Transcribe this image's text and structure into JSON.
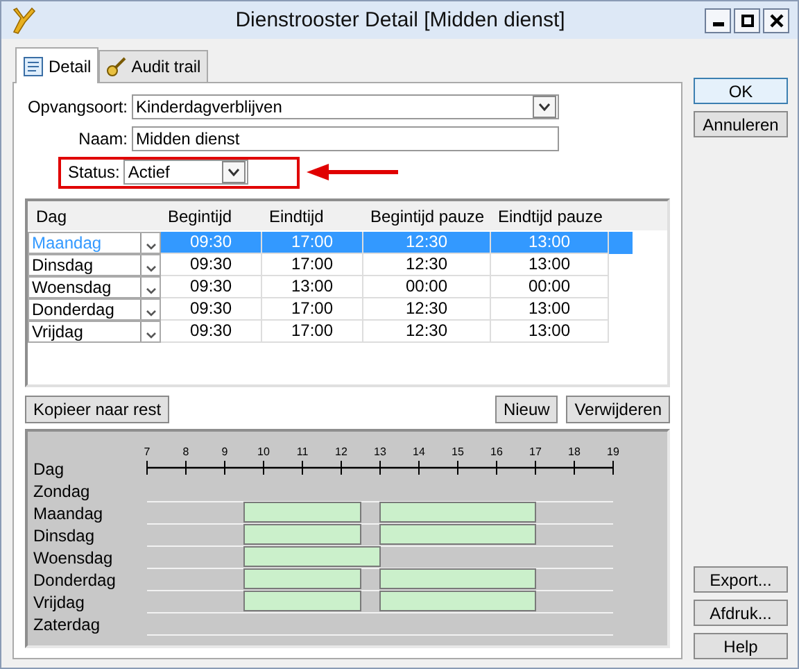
{
  "window": {
    "title": "Dienstrooster Detail [Midden dienst]"
  },
  "tabs": [
    {
      "label": "Detail",
      "selected": true
    },
    {
      "label": "Audit trail",
      "selected": false
    }
  ],
  "form": {
    "opvangsoort": {
      "label": "Opvangsoort:",
      "value": "Kinderdagverblijven"
    },
    "naam": {
      "label": "Naam:",
      "value": "Midden dienst"
    },
    "status": {
      "label": "Status:",
      "value": "Actief",
      "highlighted": true
    }
  },
  "table": {
    "columns": [
      "Dag",
      "Begintijd",
      "Eindtijd",
      "Begintijd pauze",
      "Eindtijd pauze"
    ],
    "rows": [
      {
        "cells": [
          "Maandag",
          "09:30",
          "17:00",
          "12:30",
          "13:00"
        ],
        "selected": true
      },
      {
        "cells": [
          "Dinsdag",
          "09:30",
          "17:00",
          "12:30",
          "13:00"
        ],
        "selected": false
      },
      {
        "cells": [
          "Woensdag",
          "09:30",
          "13:00",
          "00:00",
          "00:00"
        ],
        "selected": false
      },
      {
        "cells": [
          "Donderdag",
          "09:30",
          "17:00",
          "12:30",
          "13:00"
        ],
        "selected": false
      },
      {
        "cells": [
          "Vrijdag",
          "09:30",
          "17:00",
          "12:30",
          "13:00"
        ],
        "selected": false
      }
    ]
  },
  "table_buttons": [
    "Kopieer naar rest",
    "Nieuw",
    "Verwijderen"
  ],
  "schedule": {
    "header": "Dag",
    "ticks": [
      "7",
      "8",
      "9",
      "10",
      "11",
      "12",
      "13",
      "14",
      "15",
      "16",
      "17",
      "18",
      "19"
    ],
    "days": [
      {
        "label": "Zondag",
        "kind": "off"
      },
      {
        "label": "Maandag",
        "kind": "scheduled"
      },
      {
        "label": "Dinsdag",
        "kind": "scheduled"
      },
      {
        "label": "Woensdag",
        "kind": "scheduled"
      },
      {
        "label": "Donderdag",
        "kind": "scheduled"
      },
      {
        "label": "Vrijdag",
        "kind": "scheduled"
      },
      {
        "label": "Zaterdag",
        "kind": "off"
      }
    ]
  },
  "side_buttons": {
    "top": [
      "OK",
      "Annuleren"
    ],
    "bottom": [
      "Export...",
      "Afdruk...",
      "Help"
    ]
  }
}
